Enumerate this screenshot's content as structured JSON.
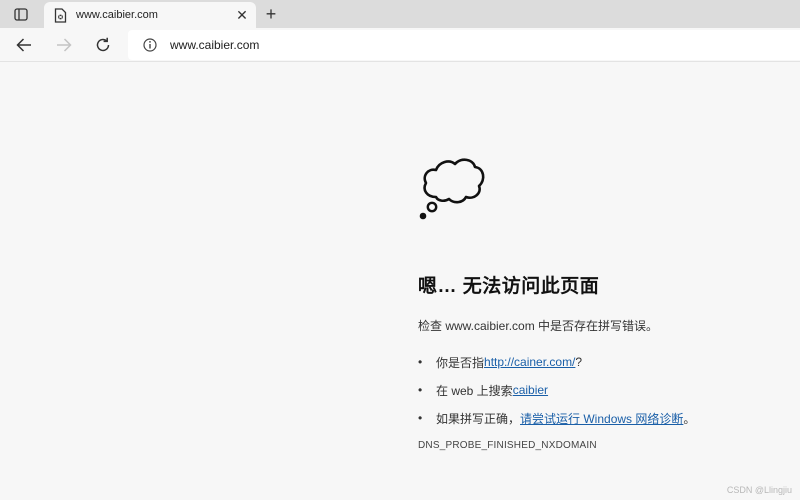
{
  "tab": {
    "title": "www.caibier.com",
    "close_label": "✕",
    "new_tab_label": "+"
  },
  "address": {
    "url": "www.caibier.com"
  },
  "error": {
    "title": "嗯… 无法访问此页面",
    "description": "检查 www.caibier.com 中是否存在拼写错误。",
    "suggestions": [
      {
        "prefix": "你是否指 ",
        "link": "http://cainer.com/",
        "suffix": "?"
      },
      {
        "prefix": "在 web 上搜索 ",
        "link": "caibier",
        "suffix": ""
      },
      {
        "prefix": "如果拼写正确，",
        "link": "请尝试运行 Windows 网络诊断",
        "suffix": "。"
      }
    ],
    "code": "DNS_PROBE_FINISHED_NXDOMAIN"
  },
  "bullet_char": "•",
  "watermark": "CSDN @Llingjiu",
  "icons": {
    "window": "window-icon",
    "favicon": "page-icon",
    "back": "back-arrow-icon",
    "forward": "forward-arrow-icon",
    "refresh": "refresh-icon",
    "info": "info-icon",
    "cloud": "thought-cloud-icon"
  },
  "colors": {
    "link": "#1a5fa8",
    "tabbar": "#dcdcdc",
    "page": "#f7f7f7"
  }
}
